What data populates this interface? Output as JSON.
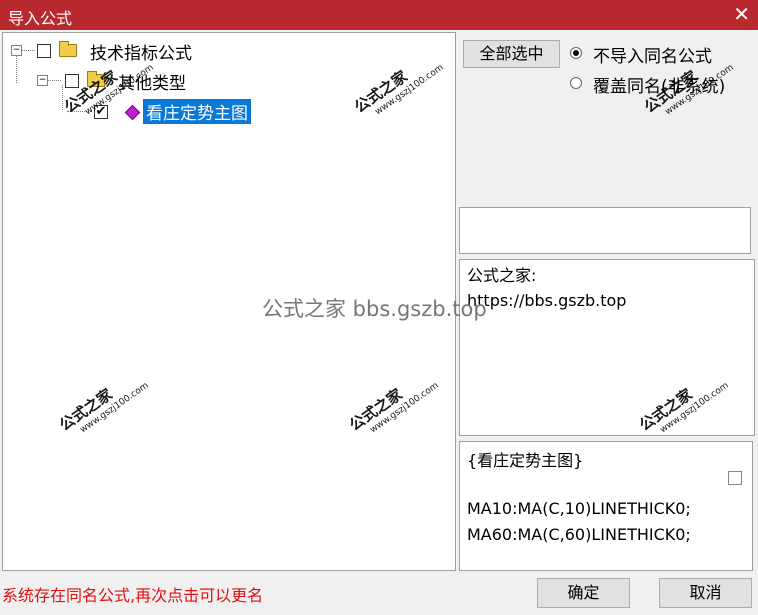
{
  "window": {
    "title": "导入公式",
    "close_glyph": "✕"
  },
  "tree": {
    "root": {
      "label": "技术指标公式",
      "expander": "⊟",
      "checked": false
    },
    "group": {
      "label": "其他类型",
      "expander": "⊟",
      "checked": false
    },
    "item": {
      "label": "看庄定势主图",
      "checked": true,
      "check_glyph": "✔"
    }
  },
  "options": {
    "select_all_label": "全部选中",
    "radio_skip_label": "不导入同名公式",
    "radio_overwrite_label": "覆盖同名(非系统)",
    "selected": "skip"
  },
  "info": {
    "line1": "公式之家:",
    "line2": "https://bbs.gszb.top"
  },
  "preview": {
    "name": "{看庄定势主图}",
    "line1": "MA10:MA(C,10)LINETHICK0;",
    "line2": "MA60:MA(C,60)LINETHICK0;"
  },
  "status": {
    "message": "系统存在同名公式,再次点击可以更名"
  },
  "buttons": {
    "ok_label": "确定",
    "cancel_label": "取消"
  },
  "watermark": {
    "title": "公式之家",
    "url": "www.gszj100.com",
    "center": "公式之家 bbs.gszb.top"
  },
  "colors": {
    "titlebar": "#b8282f",
    "selection": "#0a78d7",
    "status": "#e01010"
  }
}
